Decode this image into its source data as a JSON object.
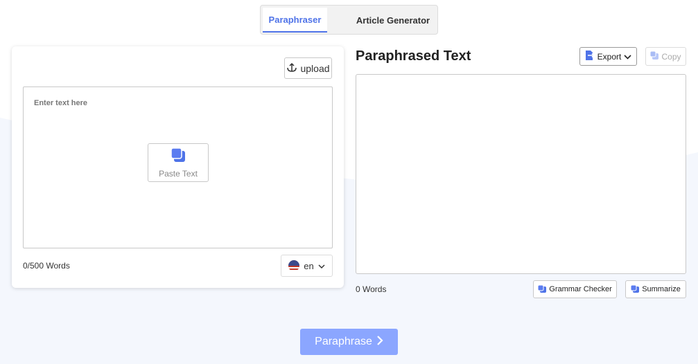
{
  "tabs": [
    {
      "label": "Paraphraser",
      "active": true
    },
    {
      "label": "Article Generator",
      "active": false
    }
  ],
  "input_panel": {
    "upload_label": "upload",
    "upload_icon": "anchor-upload-icon",
    "placeholder": "Enter text here",
    "paste_label": "Paste Text",
    "paste_icon": "paste-icon",
    "word_count": "0/500 Words",
    "language": {
      "code": "en",
      "flag": "us-flag-icon"
    }
  },
  "output_panel": {
    "title": "Paraphrased Text",
    "export_label": "Export",
    "copy_label": "Copy",
    "word_count": "0 Words",
    "grammar_label": "Grammar Checker",
    "summarize_label": "Summarize"
  },
  "action": {
    "paraphrase_label": "Paraphrase"
  },
  "colors": {
    "accent": "#4f73e8",
    "button_primary": "#8ba6ff",
    "background_tint": "#f4f7fd"
  }
}
